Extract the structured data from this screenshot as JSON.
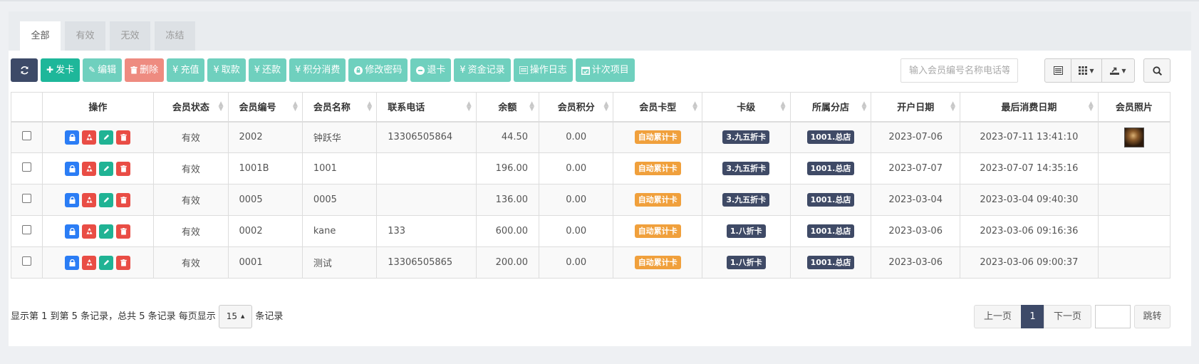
{
  "tabs": [
    {
      "label": "全部",
      "active": true
    },
    {
      "label": "有效",
      "active": false
    },
    {
      "label": "无效",
      "active": false
    },
    {
      "label": "冻结",
      "active": false
    }
  ],
  "toolbar": {
    "refresh_icon": "refresh-icon",
    "issue_card": "发卡",
    "edit": "编辑",
    "delete": "删除",
    "recharge": "充值",
    "withdraw": "取款",
    "repay": "还款",
    "points_spend": "积分消费",
    "change_password": "修改密码",
    "return_card": "退卡",
    "fund_records": "资金记录",
    "operation_log": "操作日志",
    "count_items": "计次项目",
    "currency_symbol": "¥"
  },
  "search": {
    "placeholder": "输入会员编号名称电话等"
  },
  "columns": [
    "操作",
    "会员状态",
    "会员编号",
    "会员名称",
    "联系电话",
    "余额",
    "会员积分",
    "会员卡型",
    "卡级",
    "所属分店",
    "开户日期",
    "最后消费日期",
    "会员照片"
  ],
  "rows": [
    {
      "status": "有效",
      "id": "2002",
      "name": "钟跃华",
      "phone": "13306505864",
      "balance": "44.50",
      "points": "0.00",
      "card_type": "自动累计卡",
      "level": "3.九五折卡",
      "store": "1001.总店",
      "open_date": "2023-07-06",
      "last_date": "2023-07-11 13:41:10",
      "has_photo": true
    },
    {
      "status": "有效",
      "id": "1001B",
      "name": "1001",
      "phone": "",
      "balance": "196.00",
      "points": "0.00",
      "card_type": "自动累计卡",
      "level": "3.九五折卡",
      "store": "1001.总店",
      "open_date": "2023-07-07",
      "last_date": "2023-07-07 14:35:16",
      "has_photo": false
    },
    {
      "status": "有效",
      "id": "0005",
      "name": "0005",
      "phone": "",
      "balance": "136.00",
      "points": "0.00",
      "card_type": "自动累计卡",
      "level": "3.九五折卡",
      "store": "1001.总店",
      "open_date": "2023-03-04",
      "last_date": "2023-03-04 09:40:30",
      "has_photo": false
    },
    {
      "status": "有效",
      "id": "0002",
      "name": "kane",
      "phone": "133",
      "balance": "600.00",
      "points": "0.00",
      "card_type": "自动累计卡",
      "level": "1.八折卡",
      "store": "1001.总店",
      "open_date": "2023-03-06",
      "last_date": "2023-03-06 09:16:36",
      "has_photo": false
    },
    {
      "status": "有效",
      "id": "0001",
      "name": "测试",
      "phone": "13306505865",
      "balance": "200.00",
      "points": "0.00",
      "card_type": "自动累计卡",
      "level": "1.八折卡",
      "store": "1001.总店",
      "open_date": "2023-03-06",
      "last_date": "2023-03-06 09:00:37",
      "has_photo": false
    }
  ],
  "footer": {
    "info_prefix": "显示第 1 到第 5 条记录，总共 5 条记录 每页显示",
    "page_size": "15",
    "info_suffix": "条记录",
    "prev": "上一页",
    "current_page": "1",
    "next": "下一页",
    "jump": "跳转"
  },
  "colors": {
    "accent": "#3d4a68",
    "green": "#1eb79a",
    "light_green": "#6fd0be",
    "red": "#ee8b80",
    "orange": "#f0a03c"
  }
}
